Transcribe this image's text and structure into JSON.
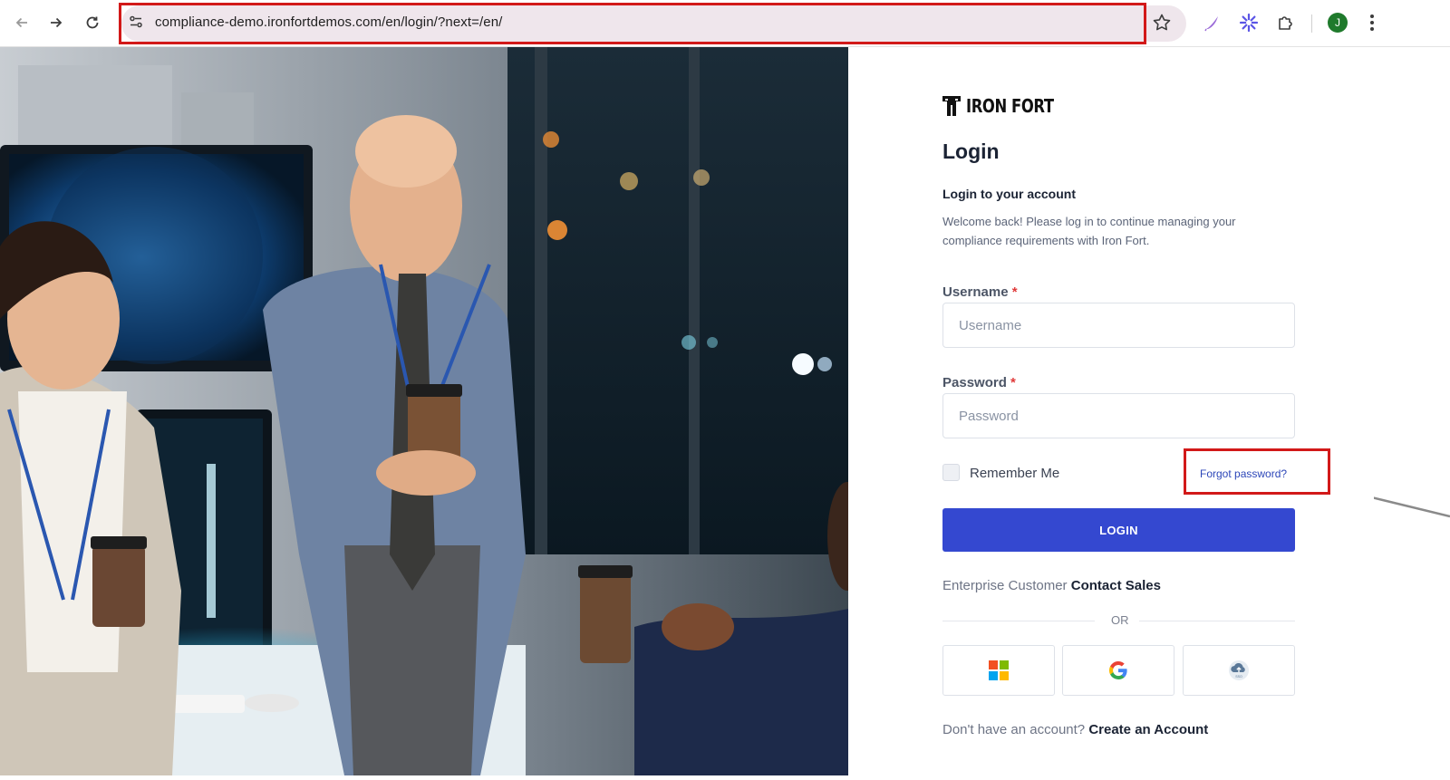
{
  "browser": {
    "url": "compliance-demo.ironfortdemos.com/en/login/?next=/en/",
    "profile_initial": "J",
    "icons": [
      "back-icon",
      "forward-icon",
      "reload-icon",
      "site-info-icon",
      "bookmark-star-icon",
      "pen-extension-icon",
      "asterisk-extension-icon",
      "puzzle-extensions-icon",
      "kebab-menu-icon"
    ]
  },
  "brand": {
    "name": "IRON FORT"
  },
  "login": {
    "title": "Login",
    "subtitle": "Login to your account",
    "welcome": "Welcome back! Please log in to continue managing your compliance requirements with Iron Fort.",
    "username_label": "Username",
    "username_placeholder": "Username",
    "password_label": "Password",
    "password_placeholder": "Password",
    "required_mark": "*",
    "remember_label": "Remember Me",
    "forgot_label": "Forgot password?",
    "button_label": "LOGIN",
    "enterprise_text": "Enterprise Customer",
    "contact_sales": "Contact Sales",
    "or_text": "OR",
    "signup_text": "Don't have an account?",
    "signup_link": "Create an Account"
  },
  "social": [
    {
      "name": "microsoft-icon"
    },
    {
      "name": "google-icon"
    },
    {
      "name": "sso-icon",
      "label": "SSO"
    }
  ],
  "colors": {
    "primary": "#3448d0",
    "highlight": "#d21919",
    "link": "#2c46b8",
    "heading": "#1b2334"
  }
}
